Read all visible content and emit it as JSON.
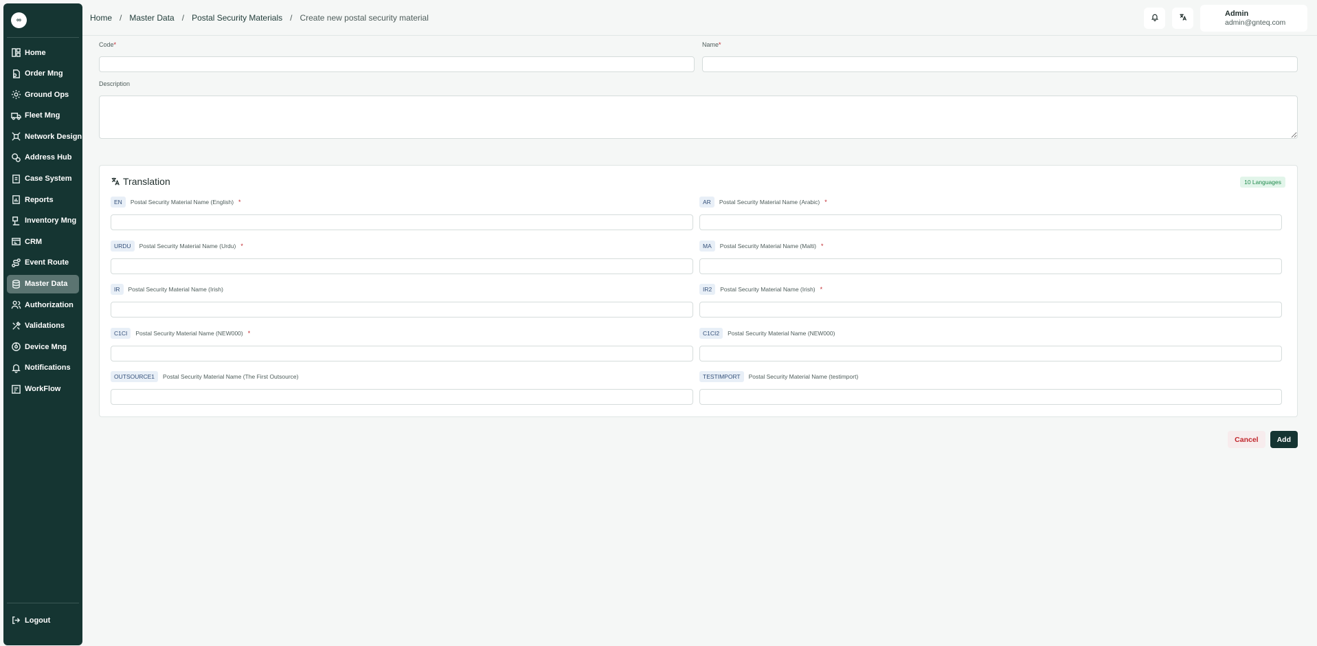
{
  "app": {
    "logo_text": "∞"
  },
  "sidebar": {
    "items": [
      {
        "label": "Home",
        "icon": "layout-icon"
      },
      {
        "label": "Order Mng",
        "icon": "order-icon"
      },
      {
        "label": "Ground Ops",
        "icon": "ground-ops-icon"
      },
      {
        "label": "Fleet Mng",
        "icon": "truck-icon"
      },
      {
        "label": "Network Design",
        "icon": "network-icon"
      },
      {
        "label": "Address Hub",
        "icon": "address-icon"
      },
      {
        "label": "Case System",
        "icon": "case-icon"
      },
      {
        "label": "Reports",
        "icon": "reports-icon"
      },
      {
        "label": "Inventory Mng",
        "icon": "inventory-icon"
      },
      {
        "label": "CRM",
        "icon": "crm-icon"
      },
      {
        "label": "Event Route",
        "icon": "route-icon"
      },
      {
        "label": "Master Data",
        "icon": "database-icon",
        "active": true
      },
      {
        "label": "Authorization",
        "icon": "users-icon"
      },
      {
        "label": "Validations",
        "icon": "validations-icon"
      },
      {
        "label": "Device Mng",
        "icon": "device-icon"
      },
      {
        "label": "Notifications",
        "icon": "bell-icon"
      },
      {
        "label": "WorkFlow",
        "icon": "workflow-icon"
      }
    ],
    "logout_label": "Logout"
  },
  "header": {
    "breadcrumb": [
      "Home",
      "Master Data",
      "Postal Security Materials",
      "Create new postal security material"
    ],
    "separator": "/",
    "user": {
      "name": "Admin",
      "email": "admin@gnteq.com"
    }
  },
  "form": {
    "code_label": "Code",
    "name_label": "Name",
    "description_label": "Description",
    "required_mark": "*",
    "code_value": "",
    "name_value": "",
    "description_value": ""
  },
  "translation": {
    "title": "Translation",
    "badge": "10 Languages",
    "fields": [
      {
        "code": "EN",
        "label": "Postal Security Material Name (English)",
        "required": true,
        "value": ""
      },
      {
        "code": "AR",
        "label": "Postal Security Material Name (Arabic)",
        "required": true,
        "value": ""
      },
      {
        "code": "URDU",
        "label": "Postal Security Material Name (Urdu)",
        "required": true,
        "value": ""
      },
      {
        "code": "MA",
        "label": "Postal Security Material Name (Malti)",
        "required": true,
        "value": ""
      },
      {
        "code": "IR",
        "label": "Postal Security Material Name (Irish)",
        "required": false,
        "value": ""
      },
      {
        "code": "IR2",
        "label": "Postal Security Material Name (Irish)",
        "required": true,
        "value": ""
      },
      {
        "code": "C1CI",
        "label": "Postal Security Material Name (NEW000)",
        "required": true,
        "value": ""
      },
      {
        "code": "C1CI2",
        "label": "Postal Security Material Name (NEW000)",
        "required": false,
        "value": ""
      },
      {
        "code": "OUTSOURCE1",
        "label": "Postal Security Material Name (The First Outsource)",
        "required": false,
        "value": ""
      },
      {
        "code": "TESTIMPORT",
        "label": "Postal Security Material Name (testimport)",
        "required": false,
        "value": ""
      }
    ]
  },
  "actions": {
    "cancel_label": "Cancel",
    "add_label": "Add"
  },
  "colors": {
    "sidebar_bg": "#153532",
    "active_item": "#5b7471",
    "required": "#c0262c",
    "badge_green": "#1f8a4c"
  }
}
